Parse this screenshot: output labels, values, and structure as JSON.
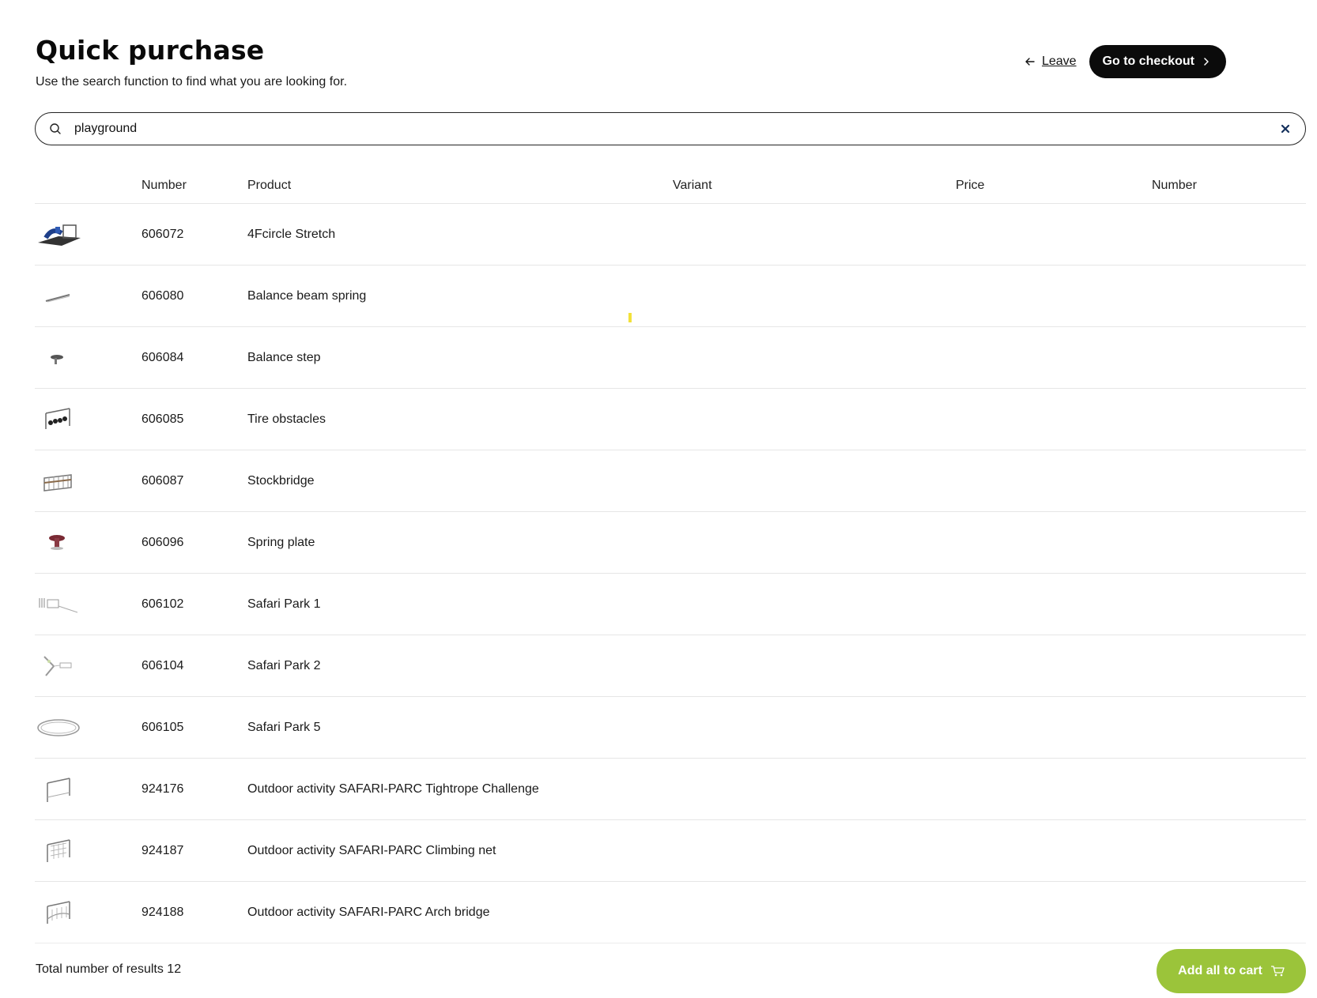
{
  "header": {
    "title": "Quick purchase",
    "subtitle": "Use the search function to find what you are looking for."
  },
  "actions": {
    "leave_label": "Leave",
    "checkout_label": "Go to checkout"
  },
  "search": {
    "value": "playground"
  },
  "table": {
    "columns": [
      "Number",
      "Product",
      "Variant",
      "Price",
      "Number"
    ],
    "rows": [
      {
        "number": "606072",
        "product": "4Fcircle Stretch",
        "thumb": "stretch-frame"
      },
      {
        "number": "606080",
        "product": "Balance beam spring",
        "thumb": "beam"
      },
      {
        "number": "606084",
        "product": "Balance step",
        "thumb": "step"
      },
      {
        "number": "606085",
        "product": "Tire obstacles",
        "thumb": "tires"
      },
      {
        "number": "606087",
        "product": "Stockbridge",
        "thumb": "bridge"
      },
      {
        "number": "606096",
        "product": "Spring plate",
        "thumb": "plate"
      },
      {
        "number": "606102",
        "product": "Safari Park 1",
        "thumb": "safari1"
      },
      {
        "number": "606104",
        "product": "Safari Park 2",
        "thumb": "safari2"
      },
      {
        "number": "606105",
        "product": "Safari Park 5",
        "thumb": "safari5"
      },
      {
        "number": "924176",
        "product": "Outdoor activity SAFARI-PARC Tightrope Challenge",
        "thumb": "tightrope"
      },
      {
        "number": "924187",
        "product": "Outdoor activity SAFARI-PARC Climbing net",
        "thumb": "net"
      },
      {
        "number": "924188",
        "product": "Outdoor activity SAFARI-PARC Arch bridge",
        "thumb": "arch"
      }
    ]
  },
  "footer": {
    "total_label": "Total number of results 12",
    "add_all_label": "Add all to cart"
  },
  "colors": {
    "accent_green": "#9bc43a",
    "dark_button": "#0b0b0b"
  },
  "icons": {
    "search": "search-icon",
    "clear": "close-icon",
    "leave": "arrow-left-icon",
    "checkout": "chevron-right-icon",
    "cart": "cart-icon"
  }
}
